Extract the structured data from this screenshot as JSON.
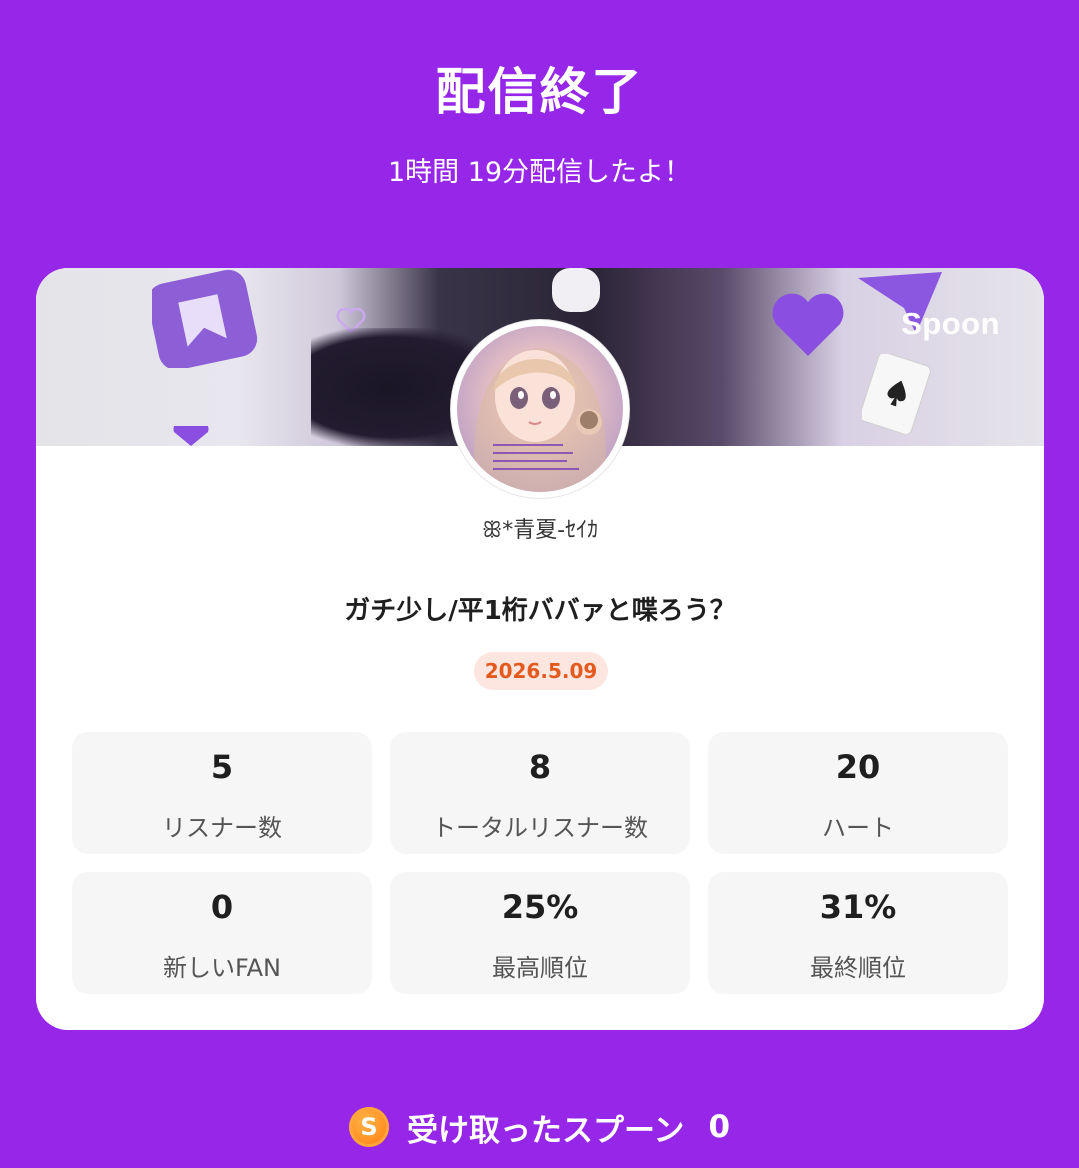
{
  "header": {
    "title": "配信終了",
    "duration_text": "1時間 19分配信したよ！"
  },
  "card": {
    "brand": "Spoon",
    "username": "ꕥ*青夏-ｾｲｶ",
    "stream_title": "ガチ少し/平1桁ババァと喋ろう？",
    "date": "2026.5.09",
    "stats": [
      {
        "value": "5",
        "label": "リスナー数"
      },
      {
        "value": "8",
        "label": "トータルリスナー数"
      },
      {
        "value": "20",
        "label": "ハート"
      },
      {
        "value": "0",
        "label": "新しいFAN"
      },
      {
        "value": "25%",
        "label": "最高順位"
      },
      {
        "value": "31%",
        "label": "最終順位"
      }
    ]
  },
  "footer": {
    "coin_glyph": "S",
    "spoons_label": "受け取ったスプーン",
    "spoons_count": "0"
  },
  "colors": {
    "background": "#9626e8",
    "date_badge_bg": "#fde5e0",
    "date_badge_text": "#e35a1e",
    "coin": "#ff8a1d"
  }
}
